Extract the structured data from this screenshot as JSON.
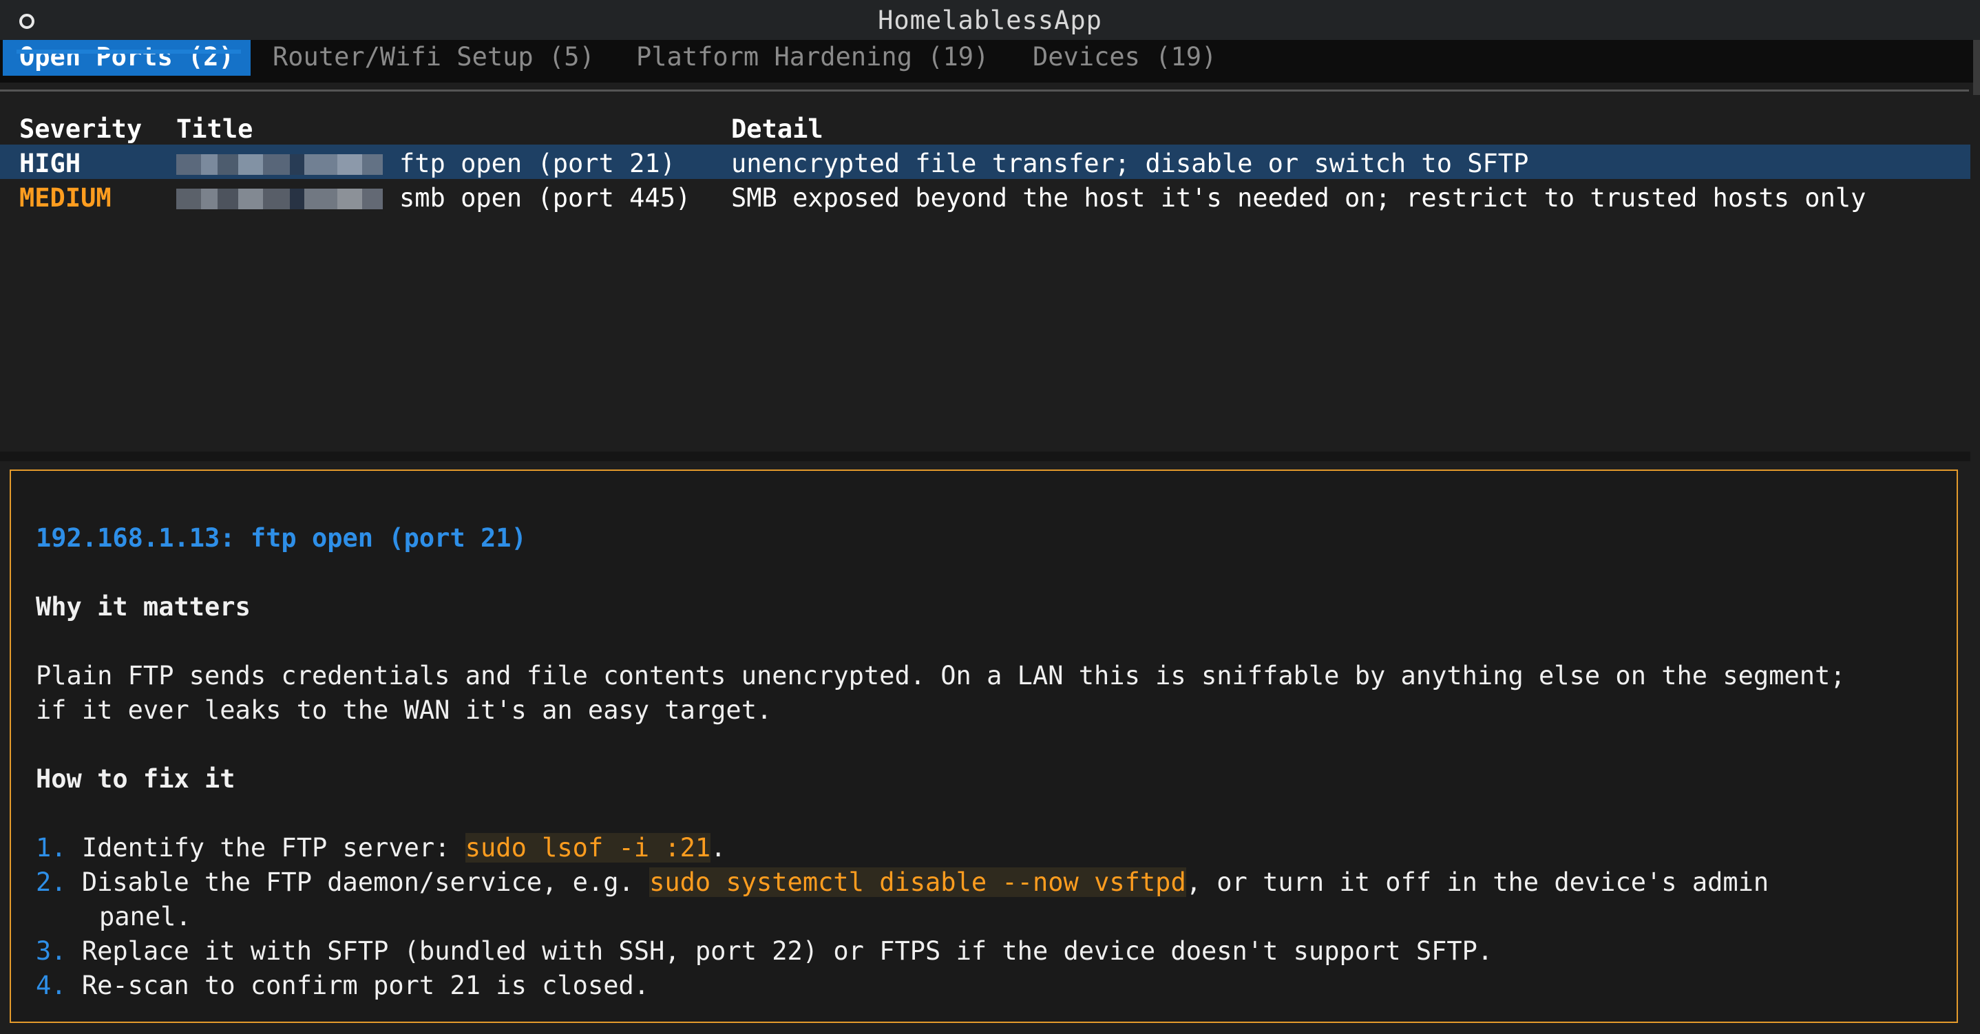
{
  "window": {
    "title": "HomelablessApp",
    "icon": "circle-icon"
  },
  "tabs": [
    {
      "label": "Open Ports (2)",
      "active": true
    },
    {
      "label": "Router/Wifi Setup (5)",
      "active": false
    },
    {
      "label": "Platform Hardening (19)",
      "active": false
    },
    {
      "label": "Devices (19)",
      "active": false
    }
  ],
  "table": {
    "headers": {
      "severity": "Severity",
      "title": "Title",
      "detail": "Detail"
    },
    "rows": [
      {
        "severity": "HIGH",
        "title": "ftp open (port 21)",
        "detail": "unencrypted file transfer; disable or switch to SFTP",
        "selected": true
      },
      {
        "severity": "MEDIUM",
        "title": "smb open (port 445)",
        "detail": "SMB exposed beyond the host it's needed on; restrict to trusted hosts only",
        "selected": false
      }
    ]
  },
  "detail": {
    "title": "192.168.1.13: ftp open (port 21)",
    "why_heading": "Why it matters",
    "why_line1": "Plain FTP sends credentials and file contents unencrypted. On a LAN this is sniffable by anything else on the segment;",
    "why_line2": "if it ever leaks to the WAN it's an easy target.",
    "fix_heading": "How to fix it",
    "steps": [
      {
        "num": "1.",
        "pre": "Identify the FTP server: ",
        "code": "sudo lsof -i :21",
        "post": "."
      },
      {
        "num": "2.",
        "pre": "Disable the FTP daemon/service, e.g. ",
        "code": "sudo systemctl disable --now vsftpd",
        "post": ", or turn it off in the device's admin",
        "cont": "panel."
      },
      {
        "num": "3.",
        "pre": "Replace it with SFTP (bundled with SSH, port 22) or FTPS if the device doesn't support SFTP."
      },
      {
        "num": "4.",
        "pre": "Re-scan to confirm port 21 is closed."
      }
    ]
  },
  "colors": {
    "accent": "#1572c8",
    "high": "#ffffff",
    "medium": "#ff9d1f",
    "panel_border": "#e39a2c",
    "link": "#2e8fe8"
  }
}
